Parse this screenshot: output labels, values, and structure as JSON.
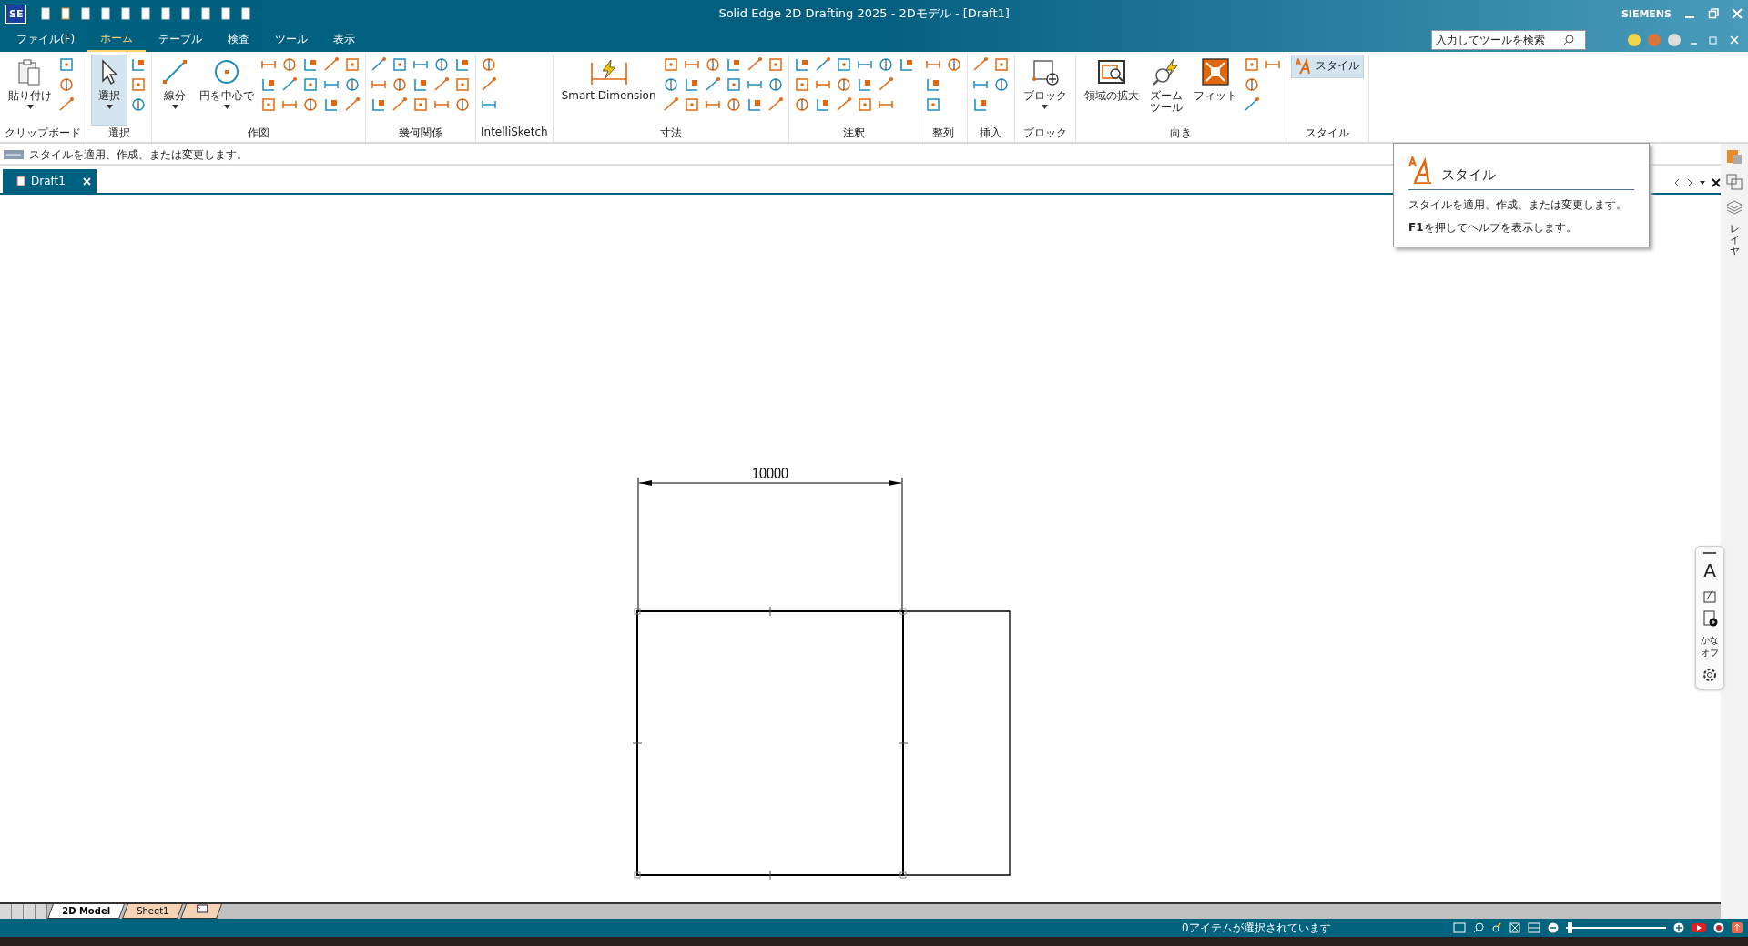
{
  "window": {
    "app_badge": "SE",
    "title": "Solid Edge 2D Drafting 2025 - 2Dモデル - [Draft1]",
    "brand": "SIEMENS"
  },
  "menu_tabs": [
    {
      "label": "ファイル(F)",
      "selected": false
    },
    {
      "label": "ホーム",
      "selected": true
    },
    {
      "label": "テーブル",
      "selected": false
    },
    {
      "label": "検査",
      "selected": false
    },
    {
      "label": "ツール",
      "selected": false
    },
    {
      "label": "表示",
      "selected": false
    }
  ],
  "search": {
    "placeholder": "入力してツールを検索"
  },
  "ribbon_groups": [
    {
      "label": "クリップボード",
      "buttons": [
        {
          "label": "貼り付け",
          "kind": "paste",
          "selected": false,
          "dropdown": true
        }
      ]
    },
    {
      "label": "選択",
      "buttons": [
        {
          "label": "選択",
          "kind": "pointer",
          "selected": true,
          "dropdown": true
        }
      ]
    },
    {
      "label": "作図",
      "buttons": [
        {
          "label": "線分",
          "kind": "line",
          "selected": false,
          "dropdown": true
        },
        {
          "label": "円を中心で",
          "kind": "circle",
          "selected": false,
          "dropdown": true
        }
      ]
    },
    {
      "label": "幾何関係"
    },
    {
      "label": "IntelliSketch"
    },
    {
      "label": "寸法",
      "buttons": [
        {
          "label": "Smart Dimension",
          "kind": "dimension",
          "selected": false
        }
      ]
    },
    {
      "label": "注釈"
    },
    {
      "label": "整列"
    },
    {
      "label": "挿入"
    },
    {
      "label": "ブロック",
      "buttons": [
        {
          "label": "ブロック",
          "kind": "block",
          "selected": false,
          "dropdown": true
        }
      ]
    },
    {
      "label": "向き",
      "buttons": [
        {
          "label": "領域の拡大",
          "kind": "zoom-area",
          "selected": false
        },
        {
          "label": "ズームツール",
          "kind": "zoom",
          "selected": false
        },
        {
          "label": "フィット",
          "kind": "fit",
          "selected": false
        }
      ]
    },
    {
      "label": "スタイル",
      "buttons": [
        {
          "label": "スタイル",
          "kind": "style",
          "selected": true
        }
      ]
    }
  ],
  "prompt": "スタイルを適用、作成、または変更します。",
  "document_tabs": [
    {
      "label": "Draft1",
      "selected": true
    }
  ],
  "drawing": {
    "dimension": "10000"
  },
  "sheet_tabs": [
    {
      "label": "2D Model",
      "selected": true
    },
    {
      "label": "Sheet1",
      "selected": false
    }
  ],
  "status": "0アイテムが選択されています",
  "zoom_slider": {
    "level": 0.02
  },
  "tooltip": {
    "title": "スタイル",
    "description": "スタイルを適用、作成、または変更します。",
    "help": "**F1**を押してヘルプを表示します。"
  },
  "side_panel": {
    "label": "レイヤ"
  },
  "ime_toolbar": {
    "letter": "A",
    "mode": "かなオフ"
  }
}
